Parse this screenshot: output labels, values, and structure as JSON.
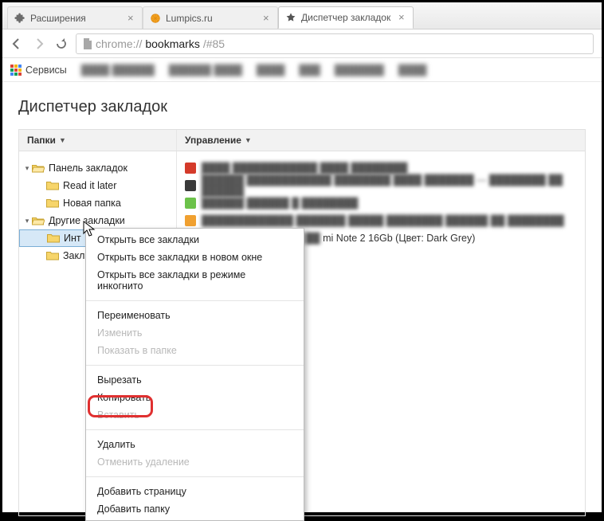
{
  "tabs": [
    {
      "title": "Расширения",
      "icon": "puzzle"
    },
    {
      "title": "Lumpics.ru",
      "icon": "orange-circle"
    },
    {
      "title": "Диспетчер закладок",
      "icon": "star",
      "active": true
    }
  ],
  "address": {
    "scheme": "chrome://",
    "host": "bookmarks",
    "path": "/#85"
  },
  "bookmarks_bar": {
    "apps_label": "Сервисы"
  },
  "page": {
    "title": "Диспетчер закладок",
    "toolbar": {
      "folders_label": "Папки",
      "manage_label": "Управление"
    }
  },
  "tree": [
    {
      "label": "Панель закладок",
      "level": 0,
      "expanded": true
    },
    {
      "label": "Read it later",
      "level": 1
    },
    {
      "label": "Новая папка",
      "level": 1
    },
    {
      "label": "Другие закладки",
      "level": 0,
      "expanded": true
    },
    {
      "label": "Инт",
      "level": 1,
      "selected": true
    },
    {
      "label": "Закладі",
      "level": 1
    }
  ],
  "list": [
    {
      "fav_color": "#d43a2a",
      "blurred": true,
      "text": "—"
    },
    {
      "fav_color": "#3a3a3a",
      "blurred": true,
      "text": "—"
    },
    {
      "fav_color": "#6cc24a",
      "blurred": true,
      "text": "—"
    },
    {
      "fav_color": "#f0a030",
      "blurred": true,
      "text": "—"
    },
    {
      "fav_color": "#d43a2a",
      "blurred": false,
      "text": "mi Note 2 16Gb (Цвет: Dark Grey)"
    }
  ],
  "context_menu": {
    "open_all": "Открыть все закладки",
    "open_all_new_window": "Открыть все закладки в новом окне",
    "open_all_incognito": "Открыть все закладки в режиме инкогнито",
    "rename": "Переименовать",
    "edit": "Изменить",
    "show_in_folder": "Показать в папке",
    "cut": "Вырезать",
    "copy": "Копировать",
    "paste": "Вставить",
    "delete": "Удалить",
    "undo_delete": "Отменить удаление",
    "add_page": "Добавить страницу",
    "add_folder": "Добавить папку"
  }
}
